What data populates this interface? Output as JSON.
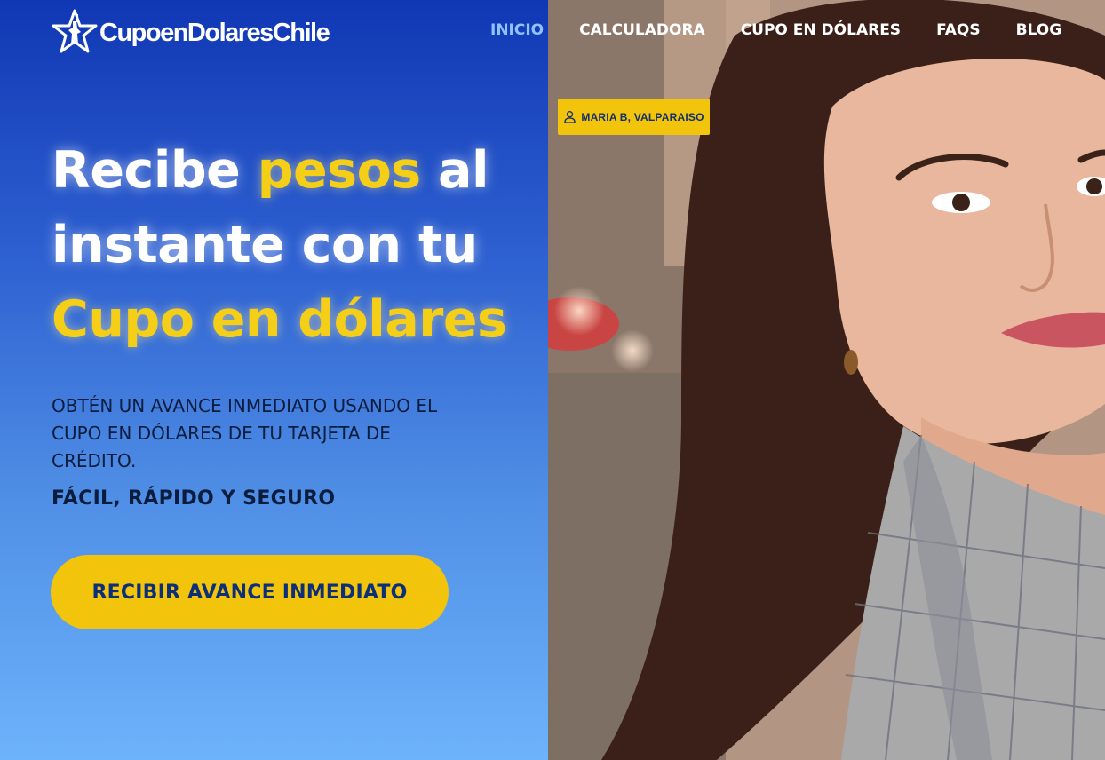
{
  "brand": {
    "name": "CupoenDolaresChile"
  },
  "nav": {
    "items": [
      {
        "label": "INICIO",
        "active": true
      },
      {
        "label": "CALCULADORA"
      },
      {
        "label": "CUPO EN DÓLARES"
      },
      {
        "label": "FAQS"
      },
      {
        "label": "BLOG"
      }
    ]
  },
  "hero": {
    "headline": {
      "part1": "Recibe ",
      "part2": "pesos",
      "part3": " al",
      "line2": "instante con tu",
      "line3": "Cupo en dólares"
    },
    "subtitle": "OBTÉN UN AVANCE INMEDIATO USANDO EL CUPO EN DÓLARES DE TU TARJETA DE CRÉDITO.",
    "tagline": "FÁCIL, RÁPIDO Y SEGURO",
    "cta_label": "RECIBIR AVANCE INMEDIATO"
  },
  "testimonial": {
    "badge_text": "MARIA B, VALPARAISO"
  },
  "icons": {
    "logo": "statue-of-liberty-star-icon",
    "badge": "user-icon"
  },
  "colors": {
    "primary_blue": "#1037b4",
    "accent_yellow": "#f2c40c",
    "nav_active": "#8fc2ff",
    "dark_text": "#0b1d3f"
  }
}
